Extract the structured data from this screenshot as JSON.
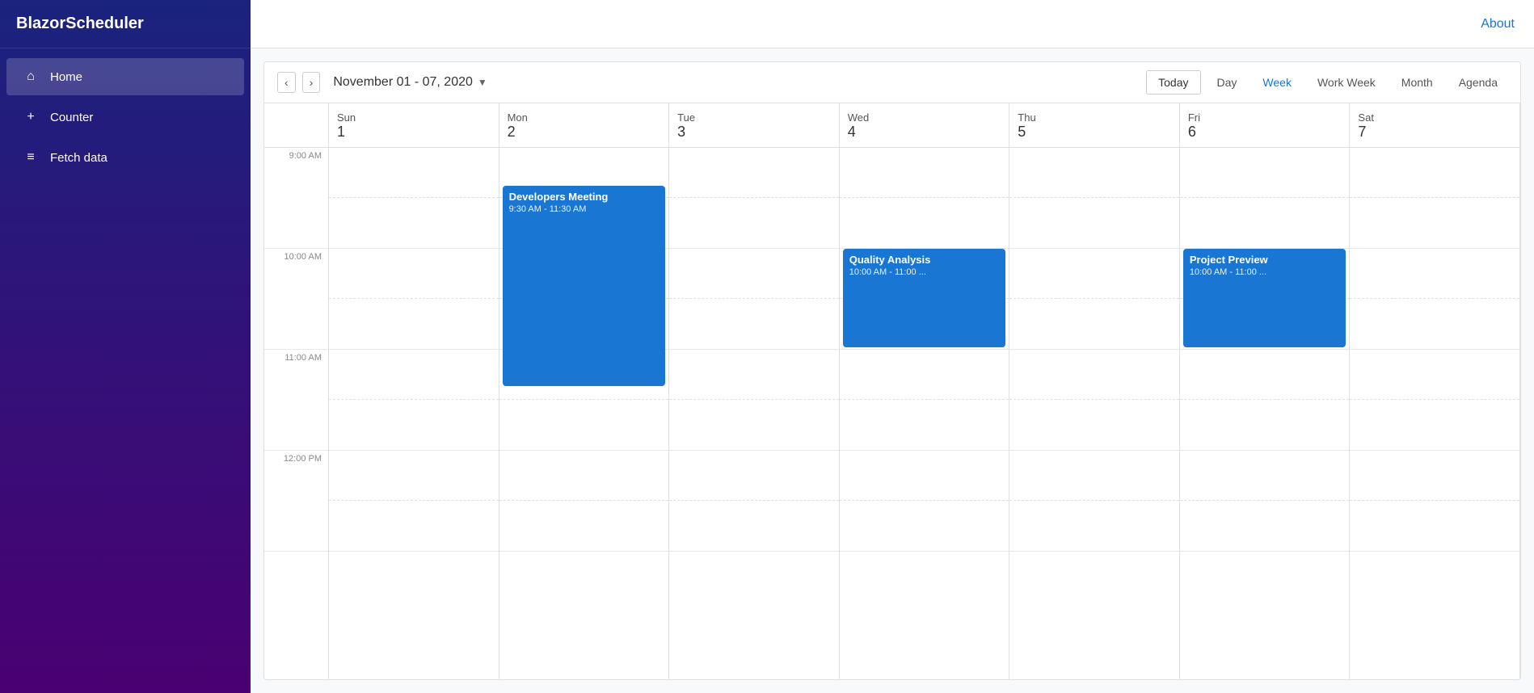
{
  "brand": "BlazorScheduler",
  "topbar": {
    "about_label": "About"
  },
  "sidebar": {
    "items": [
      {
        "id": "home",
        "label": "Home",
        "icon": "⌂",
        "active": true
      },
      {
        "id": "counter",
        "label": "Counter",
        "icon": "+",
        "active": false
      },
      {
        "id": "fetch-data",
        "label": "Fetch data",
        "icon": "≡",
        "active": false
      }
    ]
  },
  "calendar": {
    "title": "November 01 - 07, 2020",
    "views": [
      "Today",
      "Day",
      "Week",
      "Work Week",
      "Month",
      "Agenda"
    ],
    "active_view": "Week",
    "days": [
      {
        "name": "Sun",
        "num": "1"
      },
      {
        "name": "Mon",
        "num": "2"
      },
      {
        "name": "Tue",
        "num": "3"
      },
      {
        "name": "Wed",
        "num": "4"
      },
      {
        "name": "Thu",
        "num": "5"
      },
      {
        "name": "Fri",
        "num": "6"
      },
      {
        "name": "Sat",
        "num": "7"
      }
    ],
    "time_slots": [
      "9:00 AM",
      "10:00 AM",
      "11:00 AM",
      "12:00 PM"
    ],
    "events": [
      {
        "id": "developers-meeting",
        "title": "Developers Meeting",
        "time": "9:30 AM - 11:30 AM",
        "day_col": 1,
        "top_pct": 37,
        "height_pct": 200,
        "color": "#1976d2"
      },
      {
        "id": "quality-analysis",
        "title": "Quality Analysis",
        "time": "10:00 AM - 11:00 ...",
        "day_col": 3,
        "top_pct": 62,
        "height_pct": 100,
        "color": "#1976d2"
      },
      {
        "id": "project-preview",
        "title": "Project Preview",
        "time": "10:00 AM - 11:00 ...",
        "day_col": 5,
        "top_pct": 62,
        "height_pct": 100,
        "color": "#1976d2"
      }
    ]
  }
}
